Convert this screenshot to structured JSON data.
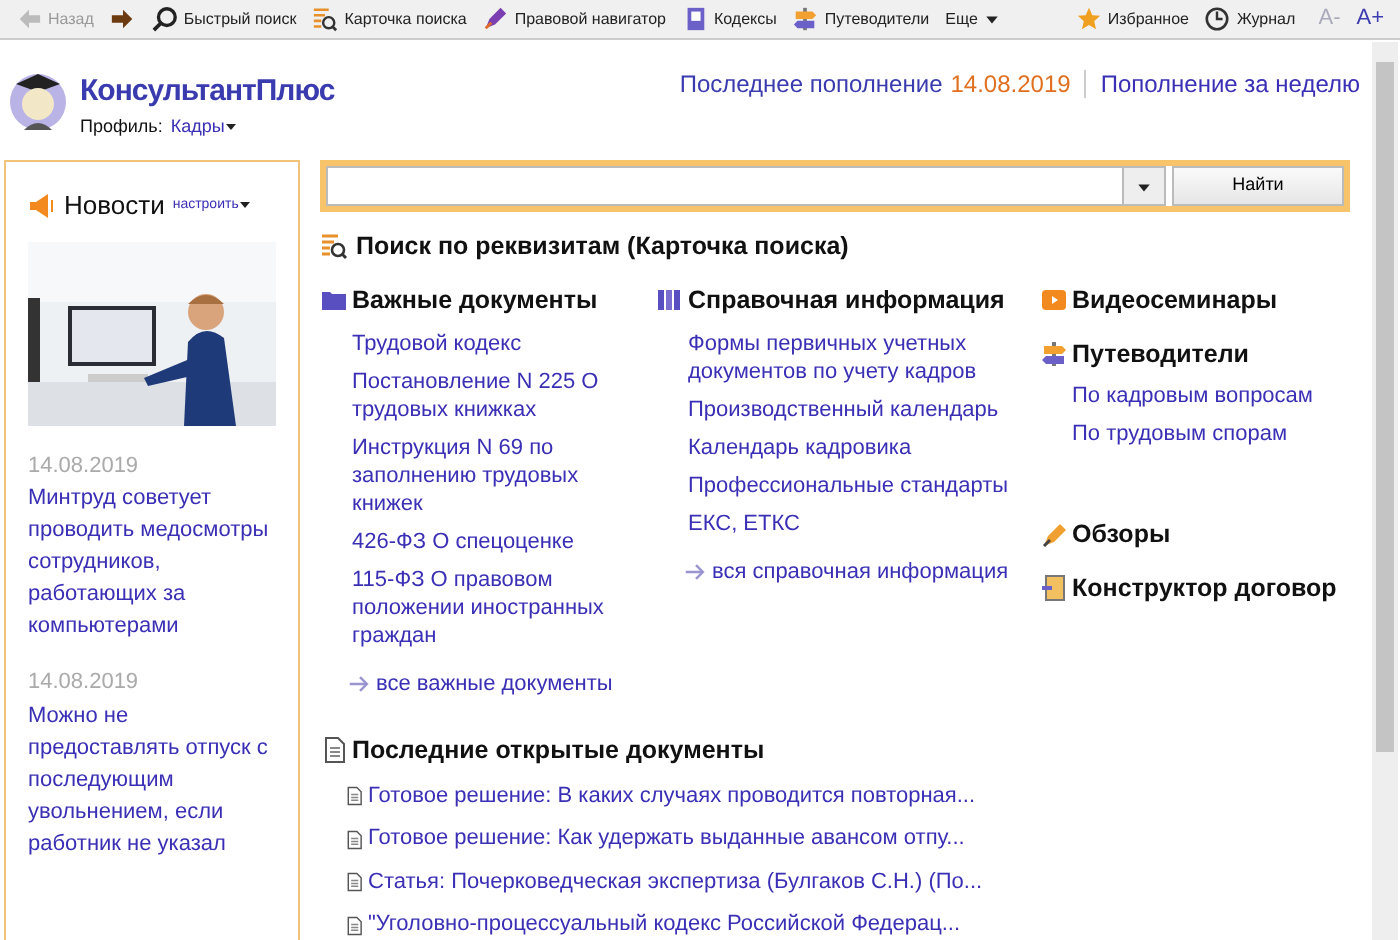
{
  "toolbar": [
    {
      "kind": "back",
      "label": "Назад",
      "disabled": true
    },
    {
      "kind": "forward"
    },
    {
      "kind": "search",
      "label": "Быстрый поиск",
      "disabled": false
    },
    {
      "kind": "card",
      "label": "Карточка поиска",
      "disabled": false
    },
    {
      "kind": "navigator",
      "label": "Правовой навигатор",
      "disabled": false
    },
    {
      "kind": "codex",
      "label": "Кодексы",
      "disabled": false
    },
    {
      "kind": "guides",
      "label": "Путеводители",
      "disabled": false
    },
    {
      "kind": "more",
      "label": "Еще",
      "disabled": false
    },
    {
      "kind": "favorites",
      "label": "Избранное",
      "disabled": false
    },
    {
      "kind": "journal",
      "label": "Журнал",
      "disabled": false
    },
    {
      "kind": "font",
      "label": "A-",
      "disabled": true
    },
    {
      "kind": "font",
      "label": "A+",
      "disabled": false
    }
  ],
  "header": {
    "logo": "КонсультантПлюс",
    "profile_label": "Профиль:",
    "profile": "Кадры",
    "update_label": "Последнее пополнение",
    "update_date": "14.08.2019",
    "week_link": "Пополнение за неделю"
  },
  "news": {
    "title": "Новости",
    "configure": "настроить",
    "items": [
      {
        "kind": "picture"
      },
      {
        "date": "14.08.2019",
        "text": "Минтруд советует проводить медосмотры сотрудников, работающих за компьютерами"
      },
      {
        "date": "14.08.2019",
        "text": "Можно не предоставлять отпуск с последующим увольнением, если работник не указал"
      }
    ]
  },
  "search": {
    "button": "Найти"
  },
  "card_search": "Поиск по реквизитам (Карточка поиска)",
  "columns": [
    [
      {
        "kind": "folder",
        "title": "Важные документы",
        "links": [
          "Трудовой кодекс",
          "Постановление N 225 О трудовых книжках",
          "Инструкция N 69 по заполнению трудовых книжек",
          "426-ФЗ О спецоценке",
          "115-ФЗ О правовом положении иностранных граждан"
        ],
        "more": "все важные документы"
      }
    ],
    [
      {
        "kind": "books",
        "title": "Справочная информация",
        "links": [
          "Формы первичных учетных документов по учету кадров",
          "Производственный календарь",
          "Календарь кадровика",
          "Профессиональные стандарты",
          "ЕКС, ЕТКС"
        ],
        "more": "вся справочная информация"
      }
    ],
    [
      {
        "kind": "video",
        "title": "Видеосеминары"
      },
      {
        "kind": "guides",
        "title": "Путеводители",
        "links": [
          "По кадровым вопросам",
          "По трудовым спорам"
        ]
      },
      {
        "kind": "reviews",
        "title": "Обзоры"
      },
      {
        "kind": "constructor",
        "title": "Конструктор договор"
      }
    ]
  ],
  "recent": {
    "title": "Последние открытые документы",
    "items": [
      "Готовое решение: В каких случаях проводится повторная...",
      "Готовое решение: Как удержать выданные авансом отпу...",
      "Статья: Почерковедческая экспертиза (Булгаков С.Н.) (По...",
      "\"Уголовно-процессуальный кодекс Российской Федерац..."
    ]
  }
}
